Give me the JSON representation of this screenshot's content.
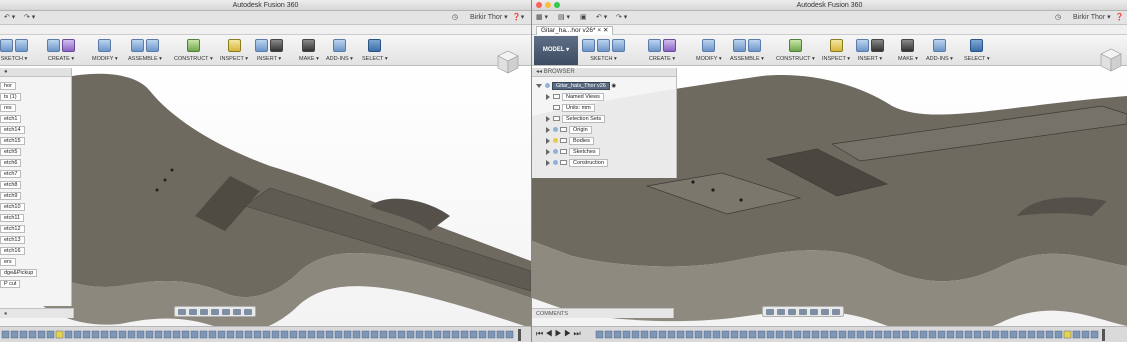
{
  "app_title": "Autodesk Fusion 360",
  "left": {
    "title": "Autodesk Fusion 360",
    "user": "Birkir Thor ▾",
    "ribbon": [
      "SKETCH ▾",
      "CREATE ▾",
      "MODIFY ▾",
      "ASSEMBLE ▾",
      "CONSTRUCT ▾",
      "INSPECT ▾",
      "INSERT ▾",
      "MAKE ▾",
      "ADD-INS ▾",
      "SELECT ▾"
    ],
    "browser_items": [
      "hor",
      "ts (1)",
      "res",
      "etch1",
      "etch14",
      "etch15",
      "etch5",
      "etch6",
      "etch7",
      "etch8",
      "etch9",
      "etch10",
      "etch11",
      "etch12",
      "etch13",
      "etch16",
      "ers",
      "dge&Pickup",
      "P cut"
    ]
  },
  "right": {
    "title": "Autodesk Fusion 360",
    "user": "Birkir Thor ▾",
    "doc_tab": "Gitar_ha...hor v26*",
    "model_label": "MODEL ▾",
    "ribbon": [
      "SKETCH ▾",
      "CREATE ▾",
      "MODIFY ▾",
      "ASSEMBLE ▾",
      "CONSTRUCT ▾",
      "INSPECT ▾",
      "INSERT ▾",
      "MAKE ▾",
      "ADD-INS ▾",
      "SELECT ▾"
    ],
    "browser_title": "BROWSER",
    "root": "Gitar_hals_Thor v26",
    "tree": [
      "Named Views",
      "Units: mm",
      "Selection Sets",
      "Origin",
      "Bodies",
      "Sketches",
      "Construction"
    ],
    "comments": "COMMENTS"
  },
  "colors": {
    "body": "#6e6a60",
    "accent": "#3a6ea8"
  }
}
